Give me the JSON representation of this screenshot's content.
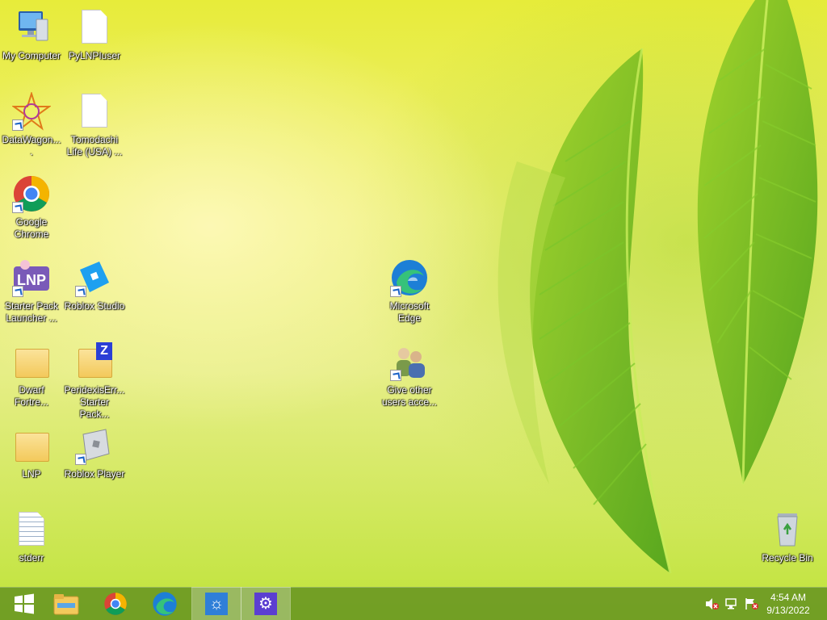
{
  "desktop": {
    "icons": [
      {
        "label": "My Computer"
      },
      {
        "label": "PyLNPIuser"
      },
      {
        "label": "DataWagon...."
      },
      {
        "label": "Tomodachi\nLife (USA) ..."
      },
      {
        "label": "Google\nChrome"
      },
      {
        "label": "Starter Pack\nLauncher ..."
      },
      {
        "label": "Roblox Studio"
      },
      {
        "label": "Microsoft\nEdge"
      },
      {
        "label": "Dwarf\nFortre..."
      },
      {
        "label": "PeridexisErr...\nStarter Pack..."
      },
      {
        "label": "Give other\nusers acce..."
      },
      {
        "label": "LNP"
      },
      {
        "label": "Roblox Player"
      },
      {
        "label": "stderr"
      },
      {
        "label": "Recycle Bin"
      }
    ]
  },
  "taskbar": {
    "buttons": [
      {
        "icon": "windows-start-icon"
      },
      {
        "icon": "file-explorer-icon"
      },
      {
        "icon": "chrome-icon"
      },
      {
        "icon": "edge-icon"
      },
      {
        "icon": "brightness-app-icon"
      },
      {
        "icon": "settings-gear-icon"
      }
    ],
    "tray": [
      "volume-muted-icon",
      "network-icon",
      "action-center-flag-icon"
    ],
    "clock": {
      "time": "4:54 AM",
      "date": "9/13/2022"
    }
  },
  "colors": {
    "wallpaper": "#e8ee60",
    "taskbar": "#5c8c1e",
    "settings_tile": "#5b3fd1",
    "brightness_tile": "#2f7fd8"
  }
}
